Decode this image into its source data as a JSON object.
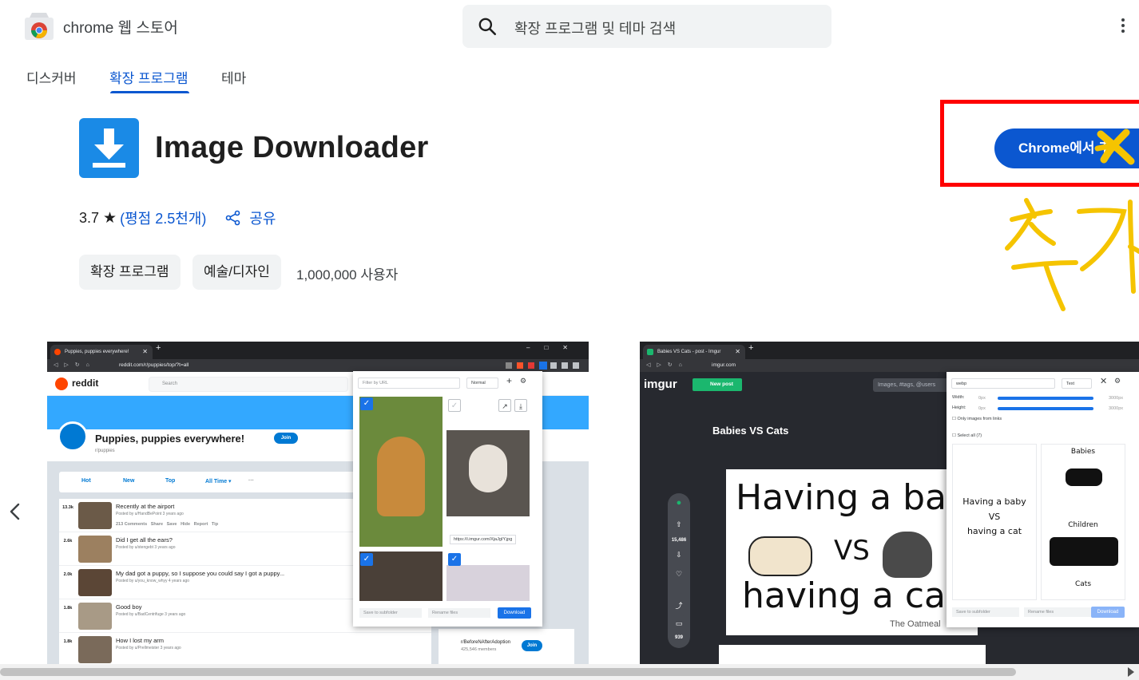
{
  "header": {
    "store_title": "chrome 웹 스토어",
    "search_placeholder": "확장 프로그램 및 테마 검색"
  },
  "nav": {
    "items": [
      {
        "label": "디스커버",
        "active": false
      },
      {
        "label": "확장 프로그램",
        "active": true
      },
      {
        "label": "테마",
        "active": false
      }
    ]
  },
  "extension": {
    "name": "Image Downloader",
    "icon": "download-arrow-icon",
    "rating": "3.7",
    "rating_link": "(평점 2.5천개)",
    "share_label": "공유",
    "chips": [
      "확장 프로그램",
      "예술/디자인"
    ],
    "users": "1,000,000 사용자",
    "add_button": "Chrome에서 추",
    "handwritten_note": "추가"
  },
  "colors": {
    "accent": "#0b57d0",
    "annotation_red": "#ff0000",
    "annotation_yellow": "#f5c400",
    "icon_blue": "#1a8ae6"
  },
  "screenshot1": {
    "tab_title": "Puppies, puppies everywhere!",
    "url": "reddit.com/r/puppies/top/?t=all",
    "site": "reddit",
    "search": "Search",
    "community_title": "Puppies, puppies everywhere!",
    "community_sub": "r/puppies",
    "join": "Join",
    "sort": [
      "Hot",
      "New",
      "Top",
      "All Time ▾",
      "···"
    ],
    "posts": [
      {
        "votes": "13.3k",
        "title": "Recently at the airport",
        "meta": "Posted by u/HandBePoint 3 years ago"
      },
      {
        "votes": "2.6k",
        "title": "Did I get all the ears?",
        "meta": "Posted by u/stengebt 3 years ago"
      },
      {
        "votes": "2.0k",
        "title": "My dad got a puppy, so I suppose you could say I got a puppy...",
        "meta": "Posted by u/you_know_whyy 4 years ago"
      },
      {
        "votes": "1.8k",
        "title": "Good boy",
        "meta": "Posted by u/BadCentrifuge 3 years ago"
      },
      {
        "votes": "1.8k",
        "title": "How I lost my arm",
        "meta": "Posted by u/Prellmeister 3 years ago"
      }
    ],
    "post_actions": [
      "213 Comments",
      "Share",
      "Save",
      "Hide",
      "Report",
      "Tip"
    ],
    "side_community": "r/BeforeNAfterAdoption",
    "side_members": "425,546 members",
    "popup": {
      "filter": "Filter by URL",
      "mode": "Normal",
      "url_tag": "https://i.imgur.com/XjaJgIY.jpg",
      "save_to": "Save to subfolder",
      "rename": "Rename files",
      "download": "Download"
    }
  },
  "screenshot2": {
    "tab_title": "Babies VS Cats - post - Imgur",
    "url": "imgur.com",
    "site": "imgur",
    "new_post": "New post",
    "search": "Images, #tags, @users",
    "post_title": "Babies VS Cats",
    "votes": "15,486",
    "comments": "939",
    "comic": {
      "line1": "Having a baby",
      "vs": "VS",
      "line2": "having a cat",
      "credit": "The Oatmeal"
    },
    "panel": {
      "filter": "webp",
      "mode": "Text",
      "width_label": "Width:",
      "height_label": "Height:",
      "min": "0px",
      "max": "3000px",
      "only_links": "Only images from links",
      "select_all": "Select all (7)",
      "card1": [
        "Having a baby",
        "VS",
        "having a cat"
      ],
      "card2": [
        "Babies",
        "Children",
        "Cats"
      ],
      "save_to": "Save to subfolder",
      "rename": "Rename files",
      "download": "Download"
    }
  }
}
